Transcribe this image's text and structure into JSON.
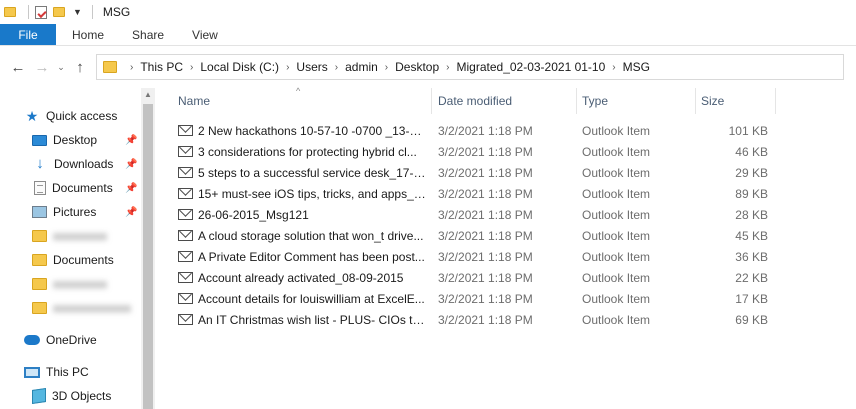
{
  "window": {
    "title": "MSG"
  },
  "ribbon": {
    "tabs": [
      "File",
      "Home",
      "Share",
      "View"
    ]
  },
  "address": {
    "path": [
      "This PC",
      "Local Disk (C:)",
      "Users",
      "admin",
      "Desktop",
      "Migrated_02-03-2021 01-10",
      "MSG"
    ]
  },
  "navigation": {
    "quick_access": "Quick access",
    "items": [
      {
        "label": "Desktop",
        "icon": "desktop-icon",
        "pinned": true
      },
      {
        "label": "Downloads",
        "icon": "download-icon",
        "pinned": true
      },
      {
        "label": "Documents",
        "icon": "documents-icon",
        "pinned": true
      },
      {
        "label": "Pictures",
        "icon": "pictures-icon",
        "pinned": true
      },
      {
        "label": "xxxxxxxxx",
        "icon": "folder-icon",
        "pinned": false,
        "blurred": true
      },
      {
        "label": "Documents",
        "icon": "folder-icon",
        "pinned": false
      },
      {
        "label": "xxxxxxxxx",
        "icon": "folder-icon",
        "pinned": false,
        "blurred": true
      },
      {
        "label": "xxxxxxxxxxxxx",
        "icon": "folder-icon",
        "pinned": false,
        "blurred": true
      }
    ],
    "onedrive": "OneDrive",
    "this_pc": "This PC",
    "objects_3d": "3D Objects"
  },
  "columns": {
    "name": "Name",
    "date": "Date modified",
    "type": "Type",
    "size": "Size"
  },
  "files": [
    {
      "name": "2 New hackathons 10-57-10 -0700 _13-08....",
      "date": "3/2/2021 1:18 PM",
      "type": "Outlook Item",
      "size": "101 KB"
    },
    {
      "name": "3 considerations for protecting hybrid cl...",
      "date": "3/2/2021 1:18 PM",
      "type": "Outlook Item",
      "size": "46 KB"
    },
    {
      "name": "5 steps to a successful service desk_17-08....",
      "date": "3/2/2021 1:18 PM",
      "type": "Outlook Item",
      "size": "29 KB"
    },
    {
      "name": "15+ must-see iOS tips, tricks, and apps_1...",
      "date": "3/2/2021 1:18 PM",
      "type": "Outlook Item",
      "size": "89 KB"
    },
    {
      "name": "26-06-2015_Msg121",
      "date": "3/2/2021 1:18 PM",
      "type": "Outlook Item",
      "size": "28 KB"
    },
    {
      "name": "A cloud storage solution that won_t drive...",
      "date": "3/2/2021 1:18 PM",
      "type": "Outlook Item",
      "size": "45 KB"
    },
    {
      "name": "A Private Editor Comment has been post...",
      "date": "3/2/2021 1:18 PM",
      "type": "Outlook Item",
      "size": "36 KB"
    },
    {
      "name": "Account already activated_08-09-2015",
      "date": "3/2/2021 1:18 PM",
      "type": "Outlook Item",
      "size": "22 KB"
    },
    {
      "name": "Account details for louiswilliam at ExcelE...",
      "date": "3/2/2021 1:18 PM",
      "type": "Outlook Item",
      "size": "17 KB"
    },
    {
      "name": "An IT Christmas wish list - PLUS- CIOs ta...",
      "date": "3/2/2021 1:18 PM",
      "type": "Outlook Item",
      "size": "69 KB"
    }
  ]
}
